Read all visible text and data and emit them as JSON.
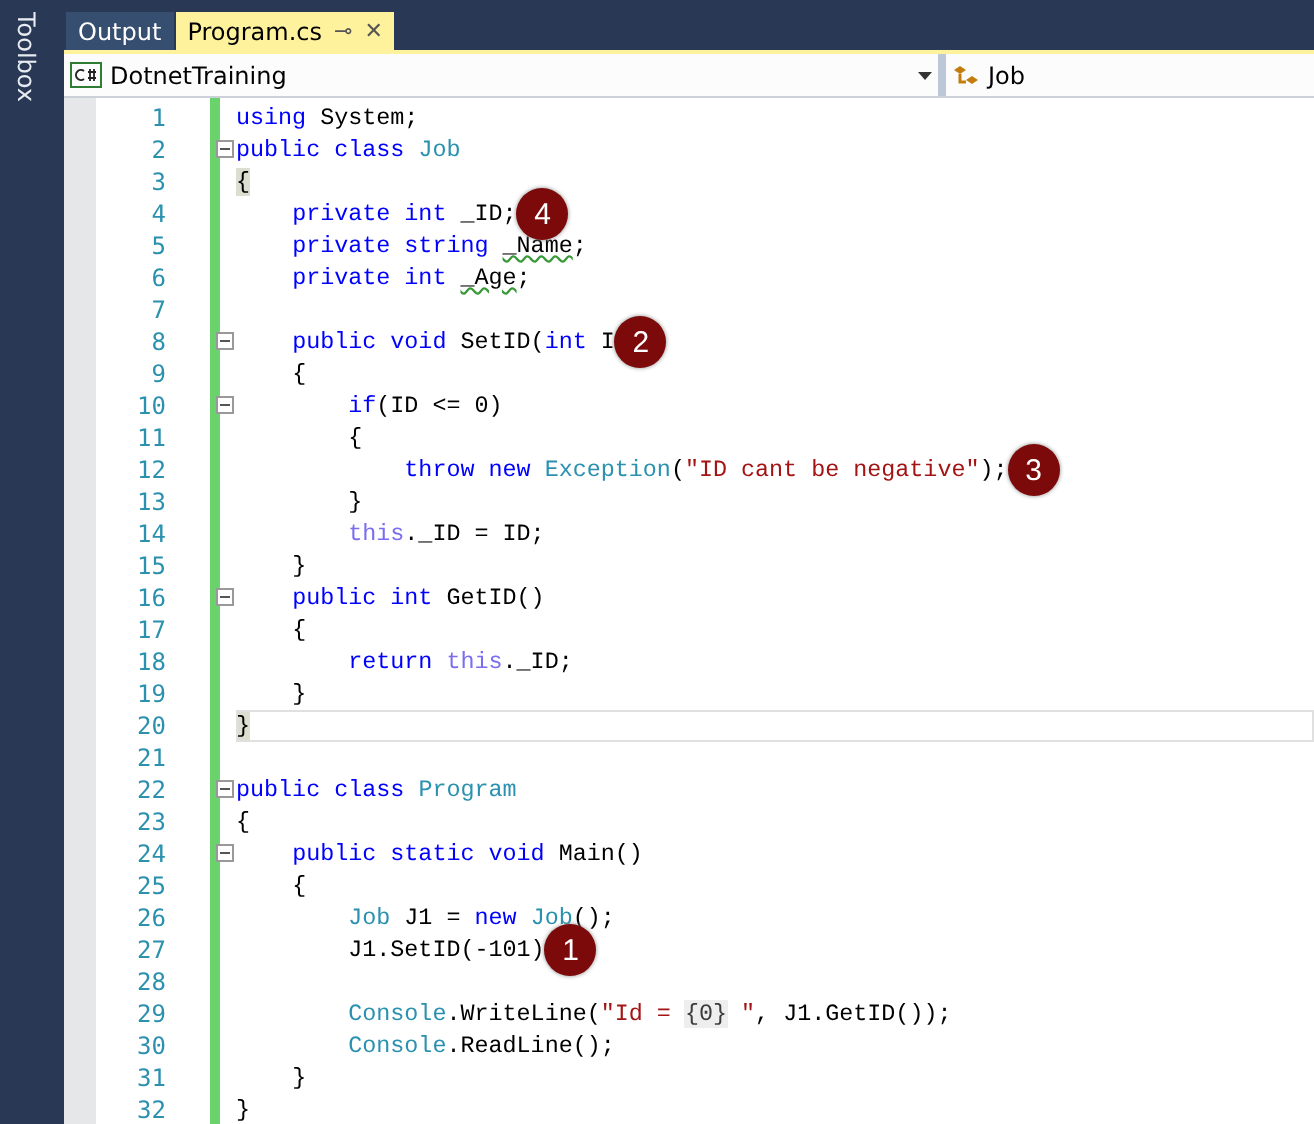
{
  "toolbox": {
    "label": "Toolbox"
  },
  "tabs": [
    {
      "label": "Output",
      "selected": false
    },
    {
      "label": "Program.cs",
      "selected": true,
      "pin": "⊸",
      "close": "✕"
    }
  ],
  "navigation": {
    "project": "DotnetTraining",
    "member": "Job"
  },
  "lines": [
    {
      "number": "1",
      "tokens": [
        {
          "kind": "keyword",
          "text": "using"
        },
        {
          "kind": "plain",
          "text": " System;"
        }
      ]
    },
    {
      "number": "2",
      "fold": true,
      "tokens": [
        {
          "kind": "keyword",
          "text": "public class"
        },
        {
          "kind": "type",
          "text": " Job"
        }
      ]
    },
    {
      "number": "3",
      "tokens": [
        {
          "kind": "brace-match",
          "text": "{"
        }
      ]
    },
    {
      "number": "4",
      "badge": "4",
      "tokens": [
        {
          "kind": "keyword",
          "text": "    private int"
        },
        {
          "kind": "plain",
          "text": " _ID;"
        }
      ]
    },
    {
      "number": "5",
      "tokens": [
        {
          "kind": "keyword",
          "text": "    private string "
        },
        {
          "kind": "warning",
          "text": "_Name"
        },
        {
          "kind": "plain",
          "text": ";"
        }
      ]
    },
    {
      "number": "6",
      "tokens": [
        {
          "kind": "keyword",
          "text": "    private int "
        },
        {
          "kind": "warning",
          "text": "_Age"
        },
        {
          "kind": "plain",
          "text": ";"
        }
      ]
    },
    {
      "number": "7"
    },
    {
      "number": "8",
      "fold": true,
      "badge": "2",
      "tokens": [
        {
          "kind": "keyword",
          "text": "    public void"
        },
        {
          "kind": "plain",
          "text": " SetID("
        },
        {
          "kind": "keyword",
          "text": "int"
        },
        {
          "kind": "plain",
          "text": " I"
        }
      ]
    },
    {
      "number": "9",
      "tokens": [
        {
          "kind": "plain",
          "text": "    {"
        }
      ]
    },
    {
      "number": "10",
      "fold": true,
      "tokens": [
        {
          "kind": "keyword",
          "text": "        if"
        },
        {
          "kind": "plain",
          "text": "(ID <= 0)"
        }
      ]
    },
    {
      "number": "11",
      "tokens": [
        {
          "kind": "plain",
          "text": "        {"
        }
      ]
    },
    {
      "number": "12",
      "badge": "3",
      "tokens": [
        {
          "kind": "keyword",
          "text": "            throw new"
        },
        {
          "kind": "type",
          "text": " Exception"
        },
        {
          "kind": "plain",
          "text": "("
        },
        {
          "kind": "string",
          "text": "\"ID cant be negative\""
        },
        {
          "kind": "plain",
          "text": ");"
        }
      ]
    },
    {
      "number": "13",
      "tokens": [
        {
          "kind": "plain",
          "text": "        }"
        }
      ]
    },
    {
      "number": "14",
      "tokens": [
        {
          "kind": "this",
          "text": "        this"
        },
        {
          "kind": "plain",
          "text": "._ID = ID;"
        }
      ]
    },
    {
      "number": "15",
      "tokens": [
        {
          "kind": "plain",
          "text": "    }"
        }
      ]
    },
    {
      "number": "16",
      "fold": true,
      "tokens": [
        {
          "kind": "keyword",
          "text": "    public int"
        },
        {
          "kind": "plain",
          "text": " GetID()"
        }
      ]
    },
    {
      "number": "17",
      "tokens": [
        {
          "kind": "plain",
          "text": "    {"
        }
      ]
    },
    {
      "number": "18",
      "tokens": [
        {
          "kind": "keyword",
          "text": "        return"
        },
        {
          "kind": "this",
          "text": " this"
        },
        {
          "kind": "plain",
          "text": "._ID;"
        }
      ]
    },
    {
      "number": "19",
      "tokens": [
        {
          "kind": "plain",
          "text": "    }"
        }
      ]
    },
    {
      "number": "20",
      "current": true,
      "tokens": [
        {
          "kind": "brace-match",
          "text": "}"
        }
      ]
    },
    {
      "number": "21"
    },
    {
      "number": "22",
      "fold": true,
      "tokens": [
        {
          "kind": "keyword",
          "text": "public class"
        },
        {
          "kind": "type",
          "text": " Program"
        }
      ]
    },
    {
      "number": "23",
      "tokens": [
        {
          "kind": "plain",
          "text": "{"
        }
      ]
    },
    {
      "number": "24",
      "fold": true,
      "tokens": [
        {
          "kind": "keyword",
          "text": "    public static void"
        },
        {
          "kind": "plain",
          "text": " Main()"
        }
      ]
    },
    {
      "number": "25",
      "tokens": [
        {
          "kind": "plain",
          "text": "    {"
        }
      ]
    },
    {
      "number": "26",
      "tokens": [
        {
          "kind": "type",
          "text": "        Job"
        },
        {
          "kind": "plain",
          "text": " J1 = "
        },
        {
          "kind": "keyword",
          "text": "new"
        },
        {
          "kind": "type",
          "text": " Job"
        },
        {
          "kind": "plain",
          "text": "();"
        }
      ]
    },
    {
      "number": "27",
      "badge": "1",
      "tokens": [
        {
          "kind": "plain",
          "text": "        J1.SetID(-101)"
        }
      ]
    },
    {
      "number": "28"
    },
    {
      "number": "29",
      "tokens": [
        {
          "kind": "type",
          "text": "        Console"
        },
        {
          "kind": "plain",
          "text": ".WriteLine("
        },
        {
          "kind": "string",
          "text": "\"Id = "
        },
        {
          "kind": "format",
          "text": "{0}"
        },
        {
          "kind": "string",
          "text": " \""
        },
        {
          "kind": "plain",
          "text": ", J1.GetID());"
        }
      ]
    },
    {
      "number": "30",
      "tokens": [
        {
          "kind": "type",
          "text": "        Console"
        },
        {
          "kind": "plain",
          "text": ".ReadLine();"
        }
      ]
    },
    {
      "number": "31",
      "tokens": [
        {
          "kind": "plain",
          "text": "    }"
        }
      ]
    },
    {
      "number": "32",
      "tokens": [
        {
          "kind": "plain",
          "text": "}"
        }
      ]
    }
  ]
}
